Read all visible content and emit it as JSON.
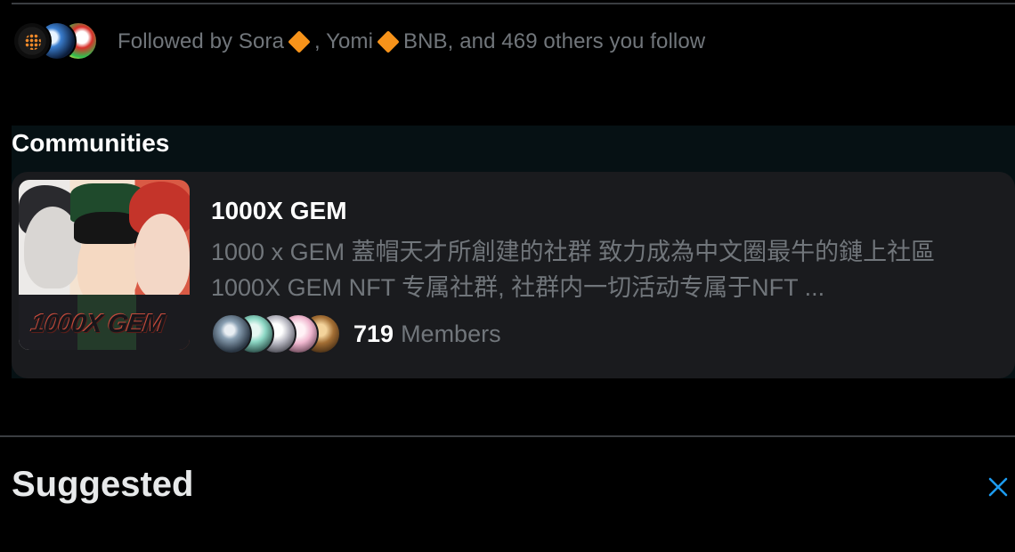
{
  "followed": {
    "prefix": "Followed by Sora",
    "separator": ", Yomi",
    "suffix": "BNB, and 469 others you follow"
  },
  "communities": {
    "title": "Communities",
    "card": {
      "thumb_logo": "1000X GEM",
      "name": "1000X GEM",
      "description": "1000 x GEM 蓋帽天才所創建的社群 致力成為中文圈最牛的鏈上社區 1000X GEM NFT 专属社群, 社群内一切活动专属于NFT ...",
      "member_count": "719",
      "member_label": "Members"
    }
  },
  "suggested": {
    "title": "Suggested",
    "close_icon": "close-icon"
  },
  "colors": {
    "background": "#000000",
    "muted_text": "#71767b",
    "card_bg": "#1a1b1e",
    "accent": "#1d9bf0",
    "diamond": "#f7931a"
  }
}
